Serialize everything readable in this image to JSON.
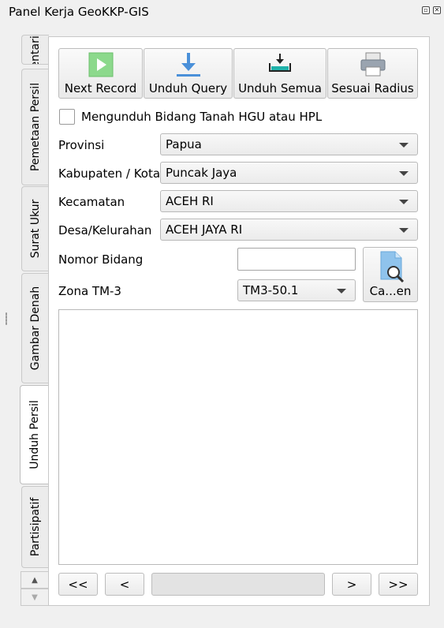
{
  "window": {
    "title": "Panel Kerja GeoKKP-GIS",
    "float_icon": "restore-icon",
    "close_icon": "close-icon"
  },
  "tabs": [
    {
      "label": "Inventarisasi"
    },
    {
      "label": "Pemetaan Persil"
    },
    {
      "label": "Surat Ukur"
    },
    {
      "label": "Gambar Denah"
    },
    {
      "label": "Unduh Persil"
    },
    {
      "label": "Partisipatif"
    }
  ],
  "toolbar": {
    "next_record": "Next Record",
    "unduh_query": "Unduh Query",
    "unduh_semua": "Unduh Semua",
    "sesuai_radius": "Sesuai Radius"
  },
  "hgu_checkbox": {
    "label": "Mengunduh Bidang Tanah HGU atau HPL",
    "checked": false
  },
  "form": {
    "provinsi_label": "Provinsi",
    "provinsi_value": "Papua",
    "kabupaten_label": "Kabupaten / Kota",
    "kabupaten_value": "Puncak Jaya",
    "kecamatan_label": "Kecamatan",
    "kecamatan_value": "ACEH RI",
    "desa_label": "Desa/Kelurahan",
    "desa_value": "ACEH JAYA RI",
    "nomor_label": "Nomor Bidang",
    "nomor_value": "",
    "zona_label": "Zona TM-3",
    "zona_value": "TM3-50.1",
    "cari_label": "Ca...en"
  },
  "nav": {
    "first": "<<",
    "prev": "<",
    "next": ">",
    "last": ">>"
  },
  "colors": {
    "accent_blue": "#4a90d9",
    "play_green": "#8cd98c",
    "teal": "#20b2aa"
  }
}
